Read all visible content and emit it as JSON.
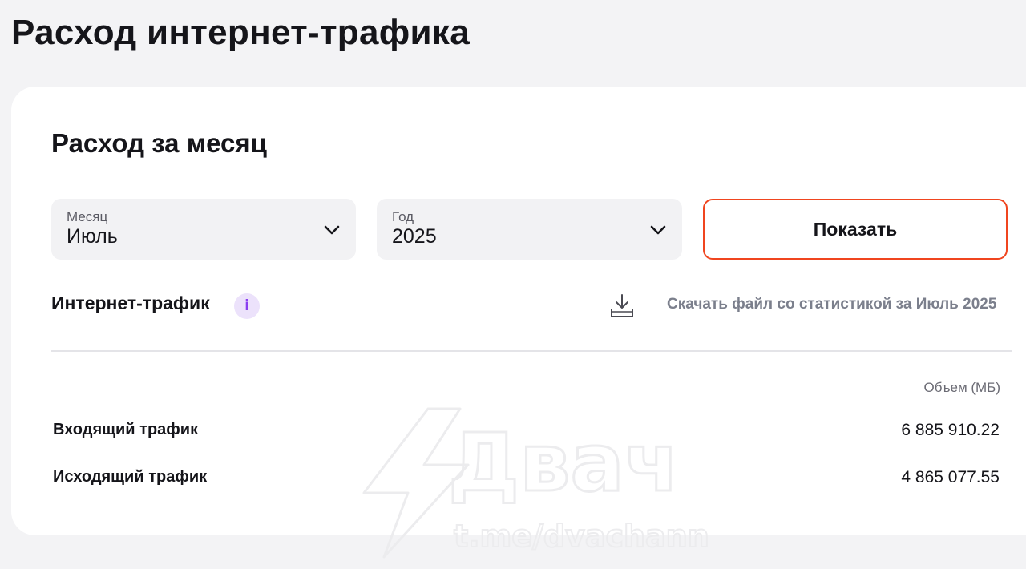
{
  "page_title": "Расход интернет-трафика",
  "section_title": "Расход за месяц",
  "filters": {
    "month": {
      "label": "Месяц",
      "value": "Июль"
    },
    "year": {
      "label": "Год",
      "value": "2025"
    },
    "show_button": "Показать"
  },
  "traffic": {
    "title": "Интернет-трафик",
    "info_icon": "i",
    "download_link": "Скачать файл со статистикой за Июль 2025",
    "column_header": "Объем (МБ)",
    "rows": [
      {
        "label": "Входящий трафик",
        "value": "6 885 910.22"
      },
      {
        "label": "Исходящий трафик",
        "value": "4 865 077.55"
      }
    ]
  },
  "watermark": {
    "brand": "Двач",
    "handle": "t.me/dvachannel"
  },
  "colors": {
    "accent_border": "#f0451f",
    "info_bg": "#ece2fb",
    "info_fg": "#8a3ff0",
    "link_gray": "#7b7f8c"
  }
}
